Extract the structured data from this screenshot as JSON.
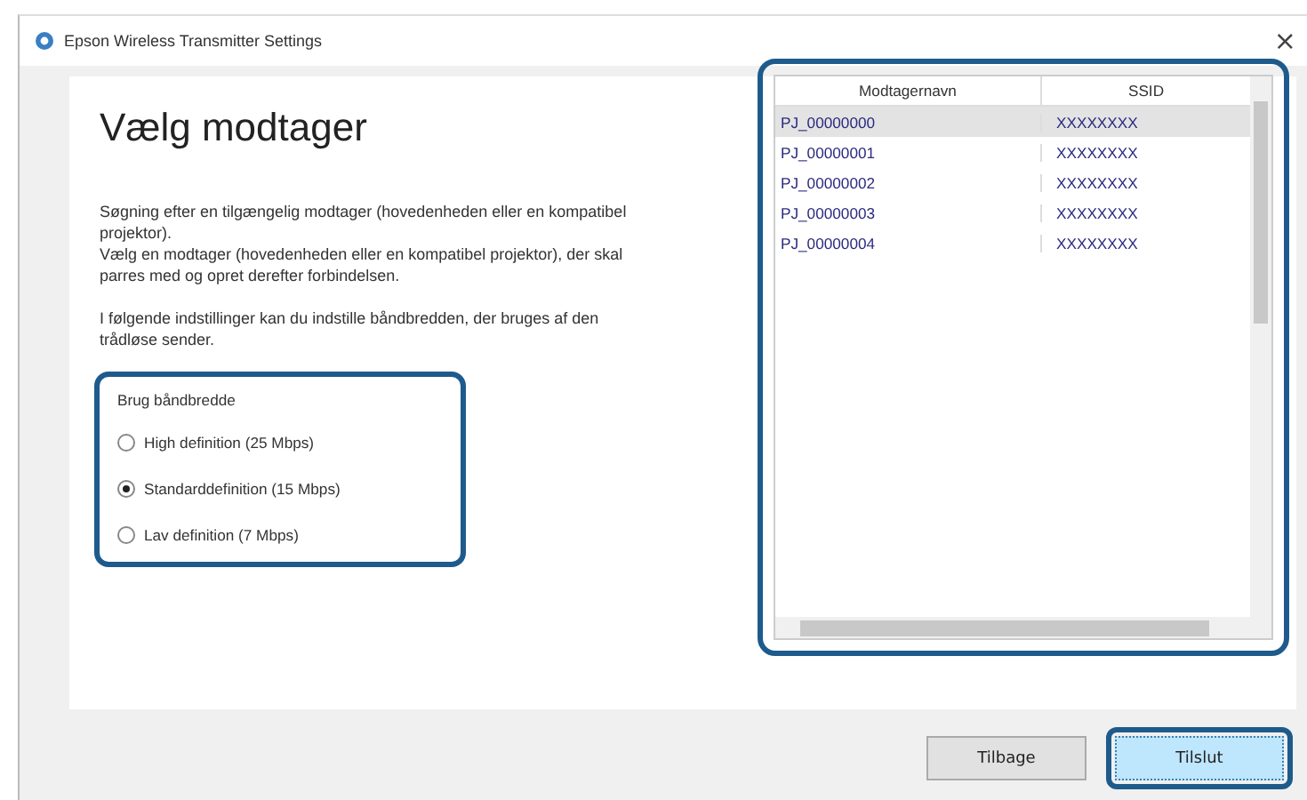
{
  "window": {
    "title": "Epson Wireless Transmitter Settings",
    "close": "×"
  },
  "heading": "Vælg modtager",
  "paragraphs": [
    "Søgning efter en tilgængelig modtager (hovedenheden eller en kompatibel projektor).\nVælg en modtager (hovedenheden eller en kompatibel projektor), der skal parres med og opret derefter forbindelsen.",
    "I følgende indstillinger kan du indstille båndbredden, der bruges af den trådløse sender."
  ],
  "bandwidth": {
    "label": "Brug båndbredde",
    "highlighted": true,
    "options": [
      {
        "label": "High definition (25 Mbps)",
        "selected": false
      },
      {
        "label": "Standarddefinition (15 Mbps)",
        "selected": true
      },
      {
        "label": "Lav definition (7 Mbps)",
        "selected": false
      }
    ]
  },
  "receivers": {
    "highlighted": true,
    "columns": [
      "Modtagernavn",
      "SSID"
    ],
    "rows": [
      {
        "name": "PJ_00000000",
        "ssid": "XXXXXXXX",
        "selected": true
      },
      {
        "name": "PJ_00000001",
        "ssid": "XXXXXXXX",
        "selected": false
      },
      {
        "name": "PJ_00000002",
        "ssid": "XXXXXXXX",
        "selected": false
      },
      {
        "name": "PJ_00000003",
        "ssid": "XXXXXXXX",
        "selected": false
      },
      {
        "name": "PJ_00000004",
        "ssid": "XXXXXXXX",
        "selected": false
      }
    ]
  },
  "buttons": [
    {
      "label": "Tilbage",
      "kind": "secondary",
      "highlighted": false
    },
    {
      "label": "Tilslut",
      "kind": "primary",
      "highlighted": true
    }
  ]
}
